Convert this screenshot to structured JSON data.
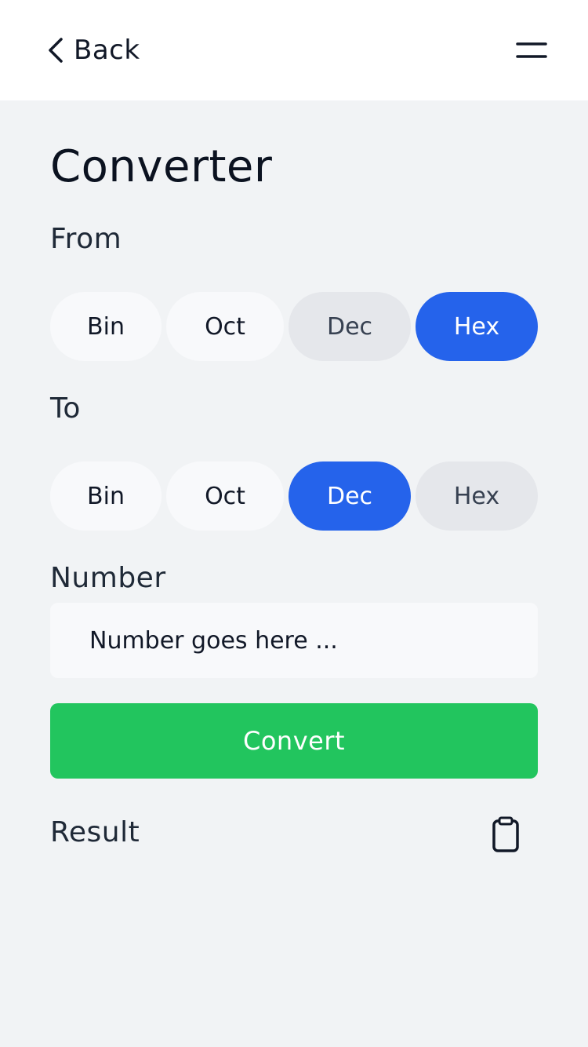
{
  "header": {
    "back_label": "Back",
    "back_icon": "chevron-left-icon",
    "menu_icon": "menu-icon"
  },
  "page": {
    "title": "Converter"
  },
  "from": {
    "label": "From",
    "options": [
      "Bin",
      "Oct",
      "Dec",
      "Hex"
    ],
    "selected": "Hex"
  },
  "to": {
    "label": "To",
    "options": [
      "Bin",
      "Oct",
      "Dec",
      "Hex"
    ],
    "selected": "Dec"
  },
  "number": {
    "label": "Number",
    "placeholder": "Number goes here ...",
    "value": ""
  },
  "convert": {
    "label": "Convert"
  },
  "result": {
    "label": "Result",
    "copy_icon": "clipboard-icon"
  },
  "colors": {
    "accent": "#2563eb",
    "convert": "#22c55e",
    "background": "#f1f3f5"
  }
}
